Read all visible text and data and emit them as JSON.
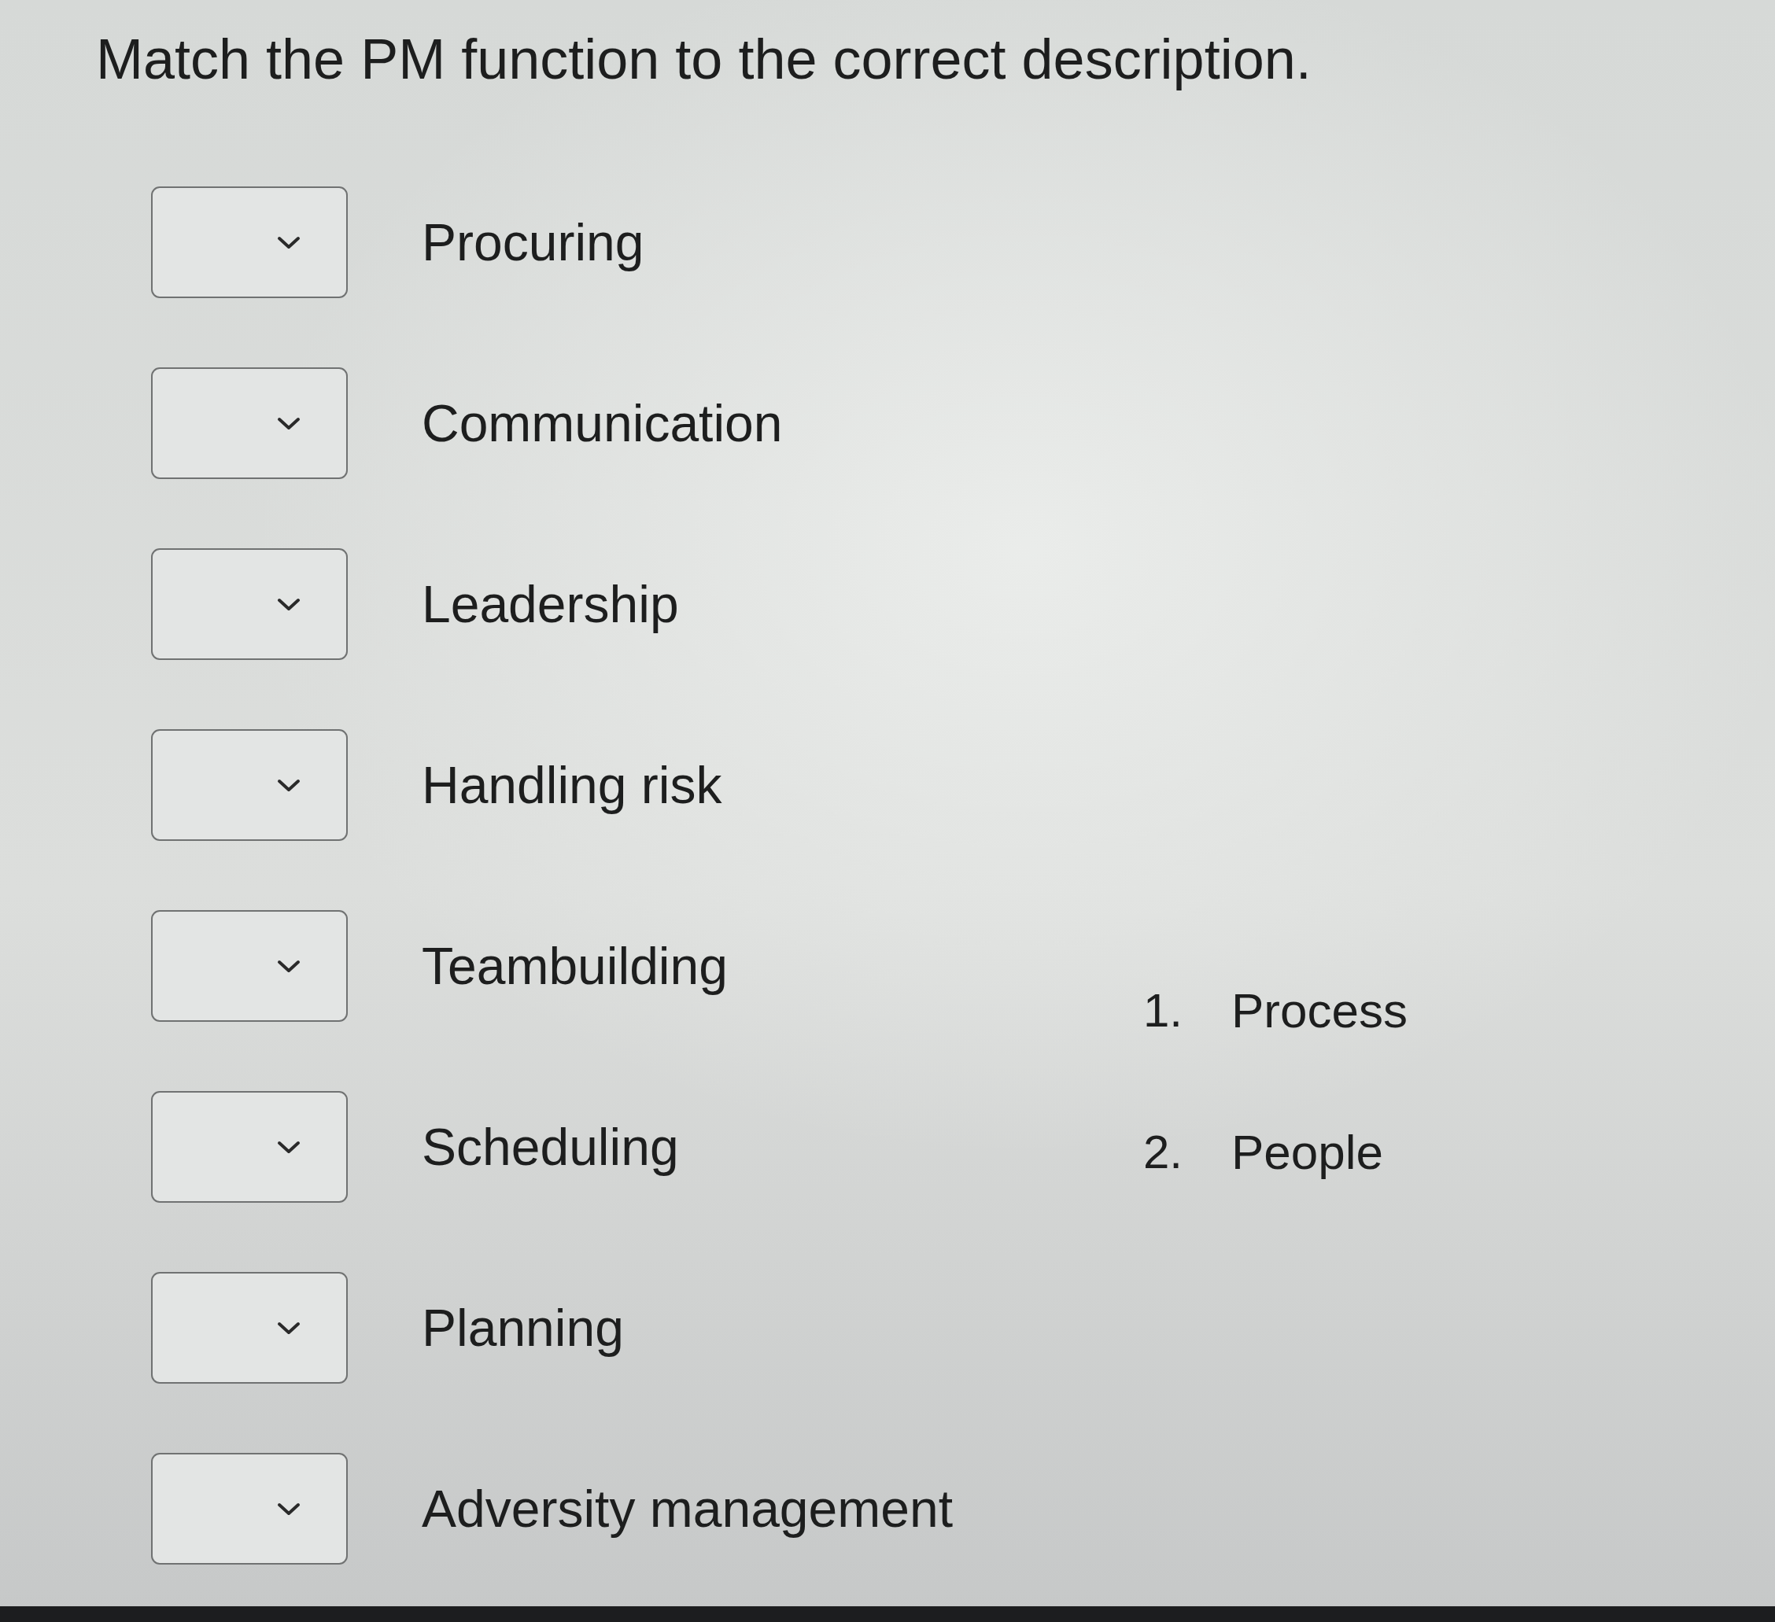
{
  "question": {
    "prompt": "Match the PM function to the correct description."
  },
  "matches": [
    {
      "label": "Procuring"
    },
    {
      "label": "Communication"
    },
    {
      "label": "Leadership"
    },
    {
      "label": "Handling risk"
    },
    {
      "label": "Teambuilding"
    },
    {
      "label": "Scheduling"
    },
    {
      "label": "Planning"
    },
    {
      "label": "Adversity management"
    }
  ],
  "options": [
    {
      "number": "1.",
      "text": "Process"
    },
    {
      "number": "2.",
      "text": "People"
    }
  ]
}
